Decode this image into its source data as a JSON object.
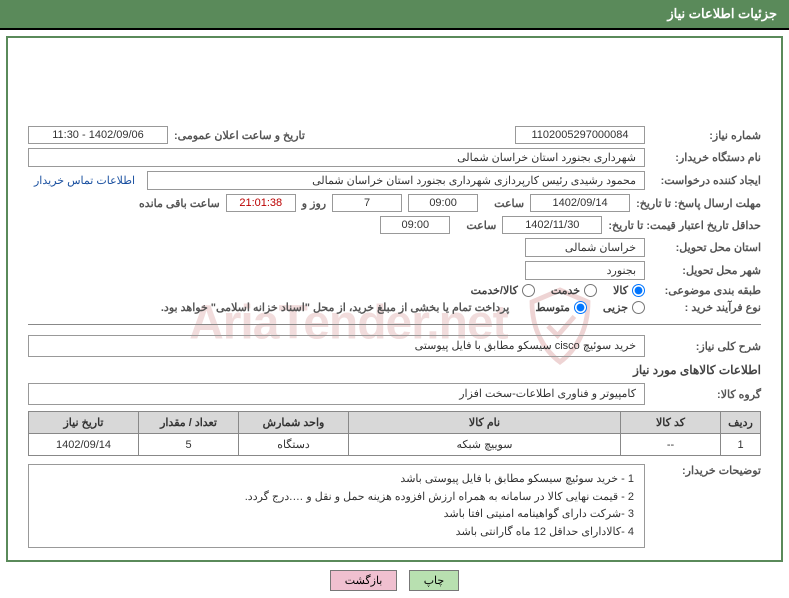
{
  "header": {
    "title": "جزئیات اطلاعات نیاز"
  },
  "fields": {
    "need_no_label": "شماره نیاز:",
    "need_no": "1102005297000084",
    "announce_label": "تاریخ و ساعت اعلان عمومی:",
    "announce": "1402/09/06 - 11:30",
    "buyer_org_label": "نام دستگاه خریدار:",
    "buyer_org": "شهرداری بجنورد استان خراسان شمالی",
    "creator_label": "ایجاد کننده درخواست:",
    "creator": "محمود رشیدی رئیس کارپردازی شهرداری بجنورد استان خراسان شمالی",
    "contact_link": "اطلاعات تماس خریدار",
    "deadline_label": "مهلت ارسال پاسخ: تا تاریخ:",
    "deadline_date": "1402/09/14",
    "time_label": "ساعت",
    "deadline_time": "09:00",
    "days": "7",
    "days_label": "روز و",
    "countdown": "21:01:38",
    "remain_label": "ساعت باقی مانده",
    "validity_label": "حداقل تاریخ اعتبار قیمت: تا تاریخ:",
    "validity_date": "1402/11/30",
    "validity_time": "09:00",
    "province_label": "استان محل تحویل:",
    "province": "خراسان شمالی",
    "city_label": "شهر محل تحویل:",
    "city": "بجنورد",
    "class_label": "طبقه بندی موضوعی:",
    "class_goods": "کالا",
    "class_service": "خدمت",
    "class_both": "کالا/خدمت",
    "proc_label": "نوع فرآیند خرید :",
    "proc_minor": "جزیی",
    "proc_medium": "متوسط",
    "proc_note": "پرداخت تمام یا بخشی از مبلغ خرید، از محل \"اسناد خزانه اسلامی\" خواهد بود."
  },
  "desc": {
    "label": "شرح کلی نیاز:",
    "value": "خرید سوئیچ cisco سیسکو مطابق با فایل پیوستی"
  },
  "goods": {
    "section_title": "اطلاعات کالاهای مورد نیاز",
    "group_label": "گروه کالا:",
    "group_value": "کامپیوتر و فناوری اطلاعات-سخت افزار"
  },
  "table": {
    "headers": [
      "ردیف",
      "کد کالا",
      "نام کالا",
      "واحد شمارش",
      "تعداد / مقدار",
      "تاریخ نیاز"
    ],
    "rows": [
      {
        "idx": "1",
        "code": "--",
        "name": "سوییچ شبکه",
        "unit": "دستگاه",
        "qty": "5",
        "date": "1402/09/14"
      }
    ]
  },
  "buyer_notes": {
    "label": "توضیحات خریدار:",
    "lines": [
      "1 - خرید سوئیچ سیسکو  مطابق با فایل پیوستی باشد",
      "2 - قیمت نهایی کالا در سامانه به همراه ارزش افزوده هزینه حمل و نقل و ….درج گردد.",
      "3 -شرکت دارای گواهینامه امنیتی افتا باشد",
      "4 -کالادارای حداقل 12 ماه گارانتی باشد"
    ]
  },
  "buttons": {
    "print": "چاپ",
    "back": "بازگشت"
  },
  "watermark": "AriaTender.net"
}
